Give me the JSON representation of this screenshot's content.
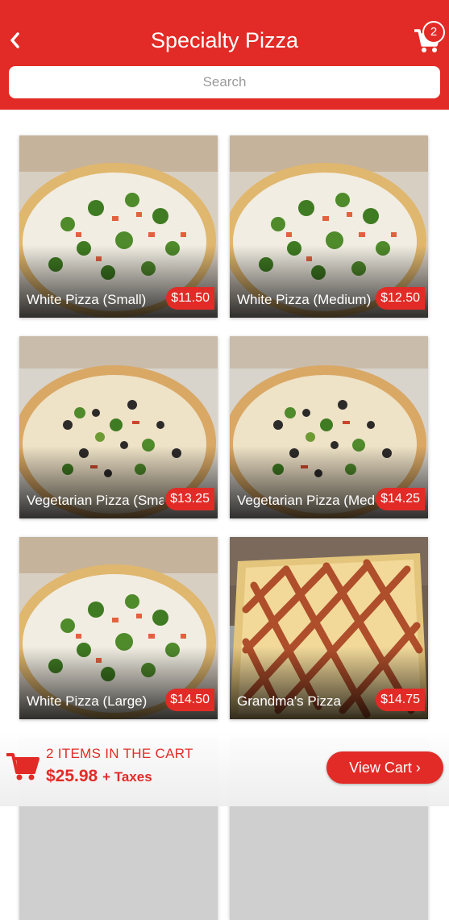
{
  "header": {
    "title": "Specialty Pizza",
    "back_icon": "chevron-left-icon",
    "cart_icon": "cart-icon",
    "cart_count": "2",
    "background_color": "#e22b26"
  },
  "search": {
    "placeholder": "Search"
  },
  "products": [
    {
      "name": "White Pizza (Small)",
      "price": "$11.50"
    },
    {
      "name": "White Pizza (Medium)",
      "price": "$12.50"
    },
    {
      "name": "Vegetarian Pizza (Small)",
      "price": "$13.25"
    },
    {
      "name": "Vegetarian Pizza (Medium)",
      "price": "$14.25"
    },
    {
      "name": "White Pizza (Large)",
      "price": "$14.50"
    },
    {
      "name": "Grandma's Pizza",
      "price": "$14.75"
    }
  ],
  "cart_bar": {
    "items_text": "2 ITEMS IN THE CART",
    "total": "$25.98",
    "taxes": "+ Taxes",
    "view_cart_label": "View Cart",
    "cart_icon": "cart-icon",
    "accent_color": "#e22b26"
  }
}
